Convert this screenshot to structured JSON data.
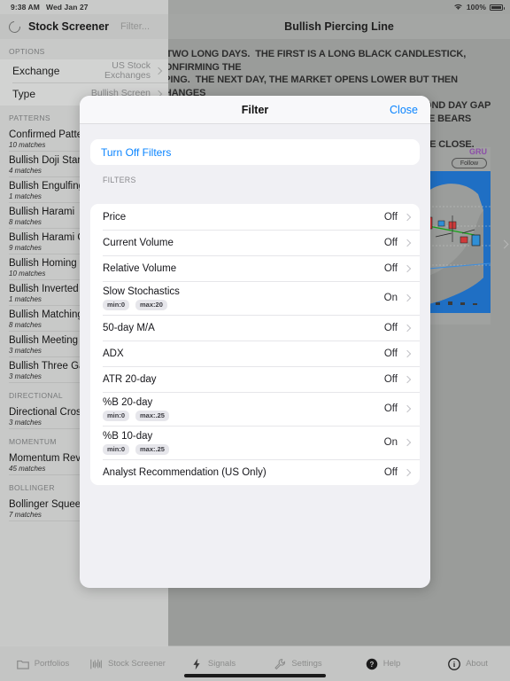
{
  "status_bar": {
    "time": "9:38 AM",
    "date": "Wed Jan 27",
    "wifi_icon": "wifi-icon",
    "battery_pct": "100%",
    "battery_icon": "battery-icon"
  },
  "sidebar": {
    "refresh_icon": "refresh-icon",
    "title": "Stock Screener",
    "filter_placeholder": "Filter...",
    "options_header": "OPTIONS",
    "options": [
      {
        "label": "Exchange",
        "value": "US Stock Exchanges"
      },
      {
        "label": "Type",
        "value": "Bullish Screen"
      }
    ],
    "sections": [
      {
        "header": "PATTERNS",
        "items": [
          {
            "name": "Confirmed Patterns",
            "matches": "10 matches"
          },
          {
            "name": "Bullish Doji Star",
            "matches": "4 matches"
          },
          {
            "name": "Bullish Engulfing",
            "matches": "1 matches"
          },
          {
            "name": "Bullish Harami",
            "matches": "8 matches"
          },
          {
            "name": "Bullish Harami Cross",
            "matches": "9 matches"
          },
          {
            "name": "Bullish Homing Pigeon",
            "matches": "10 matches"
          },
          {
            "name": "Bullish Inverted Hammer",
            "matches": "1 matches"
          },
          {
            "name": "Bullish Matching Low",
            "matches": "8 matches"
          },
          {
            "name": "Bullish Meeting Lines",
            "matches": "3 matches"
          },
          {
            "name": "Bullish Three Gaps",
            "matches": "3 matches"
          }
        ]
      },
      {
        "header": "DIRECTIONAL",
        "items": [
          {
            "name": "Directional Crossover",
            "matches": "3 matches"
          }
        ]
      },
      {
        "header": "MOMENTUM",
        "items": [
          {
            "name": "Momentum Reversal",
            "matches": "45 matches"
          }
        ]
      },
      {
        "header": "BOLLINGER",
        "items": [
          {
            "name": "Bollinger Squeeze",
            "matches": "7 matches"
          }
        ]
      }
    ]
  },
  "detail": {
    "title": "Bullish Piercing Line",
    "description": "F TWO LONG DAYS.  THE FIRST IS A LONG BLACK CANDLESTICK, CONFIRMING THE\nPPING.  THE NEXT DAY, THE MARKET OPENS LOWER BUT THEN CHANGES\nMID-POINT OF THE PREVIOUS DAY.  ALTHOUGH THE SECOND DAY GAP\nSTILL DOWNTREND), THE RAPID MOVE UP SUGGESTS THE BEARS HAVE LOST\nHER.  AND THERE WILL BE A REVERSAL.  THE HIGHER THE CLOSE, JUST",
    "chart": {
      "ticker": "GRU",
      "follow_label": "Follow",
      "next_chevron": "chevron-right-icon"
    }
  },
  "modal": {
    "title": "Filter",
    "close_label": "Close",
    "turn_off_label": "Turn Off Filters",
    "filters_header": "FILTERS",
    "filters": [
      {
        "name": "Price",
        "state": "Off",
        "pills": []
      },
      {
        "name": "Current Volume",
        "state": "Off",
        "pills": []
      },
      {
        "name": "Relative Volume",
        "state": "Off",
        "pills": []
      },
      {
        "name": "Slow Stochastics",
        "state": "On",
        "pills": [
          "min:0",
          "max:20"
        ]
      },
      {
        "name": "50-day M/A",
        "state": "Off",
        "pills": []
      },
      {
        "name": "ADX",
        "state": "Off",
        "pills": []
      },
      {
        "name": "ATR 20-day",
        "state": "Off",
        "pills": []
      },
      {
        "name": "%B 20-day",
        "state": "Off",
        "pills": [
          "min:0",
          "max:.25"
        ]
      },
      {
        "name": "%B 10-day",
        "state": "On",
        "pills": [
          "min:0",
          "max:.25"
        ]
      },
      {
        "name": "Analyst Recommendation (US Only)",
        "state": "Off",
        "pills": []
      }
    ]
  },
  "tabbar": {
    "tabs": [
      {
        "label": "Portfolios",
        "icon": "folder-icon"
      },
      {
        "label": "Stock Screener",
        "icon": "bar-chart-icon"
      },
      {
        "label": "Signals",
        "icon": "bolt-icon"
      },
      {
        "label": "Settings",
        "icon": "wrench-icon"
      },
      {
        "label": "Help",
        "icon": "question-circle-icon"
      },
      {
        "label": "About",
        "icon": "info-circle-icon"
      }
    ]
  },
  "colors": {
    "accent": "#0a84ff",
    "ticker": "#8c4ea8"
  }
}
